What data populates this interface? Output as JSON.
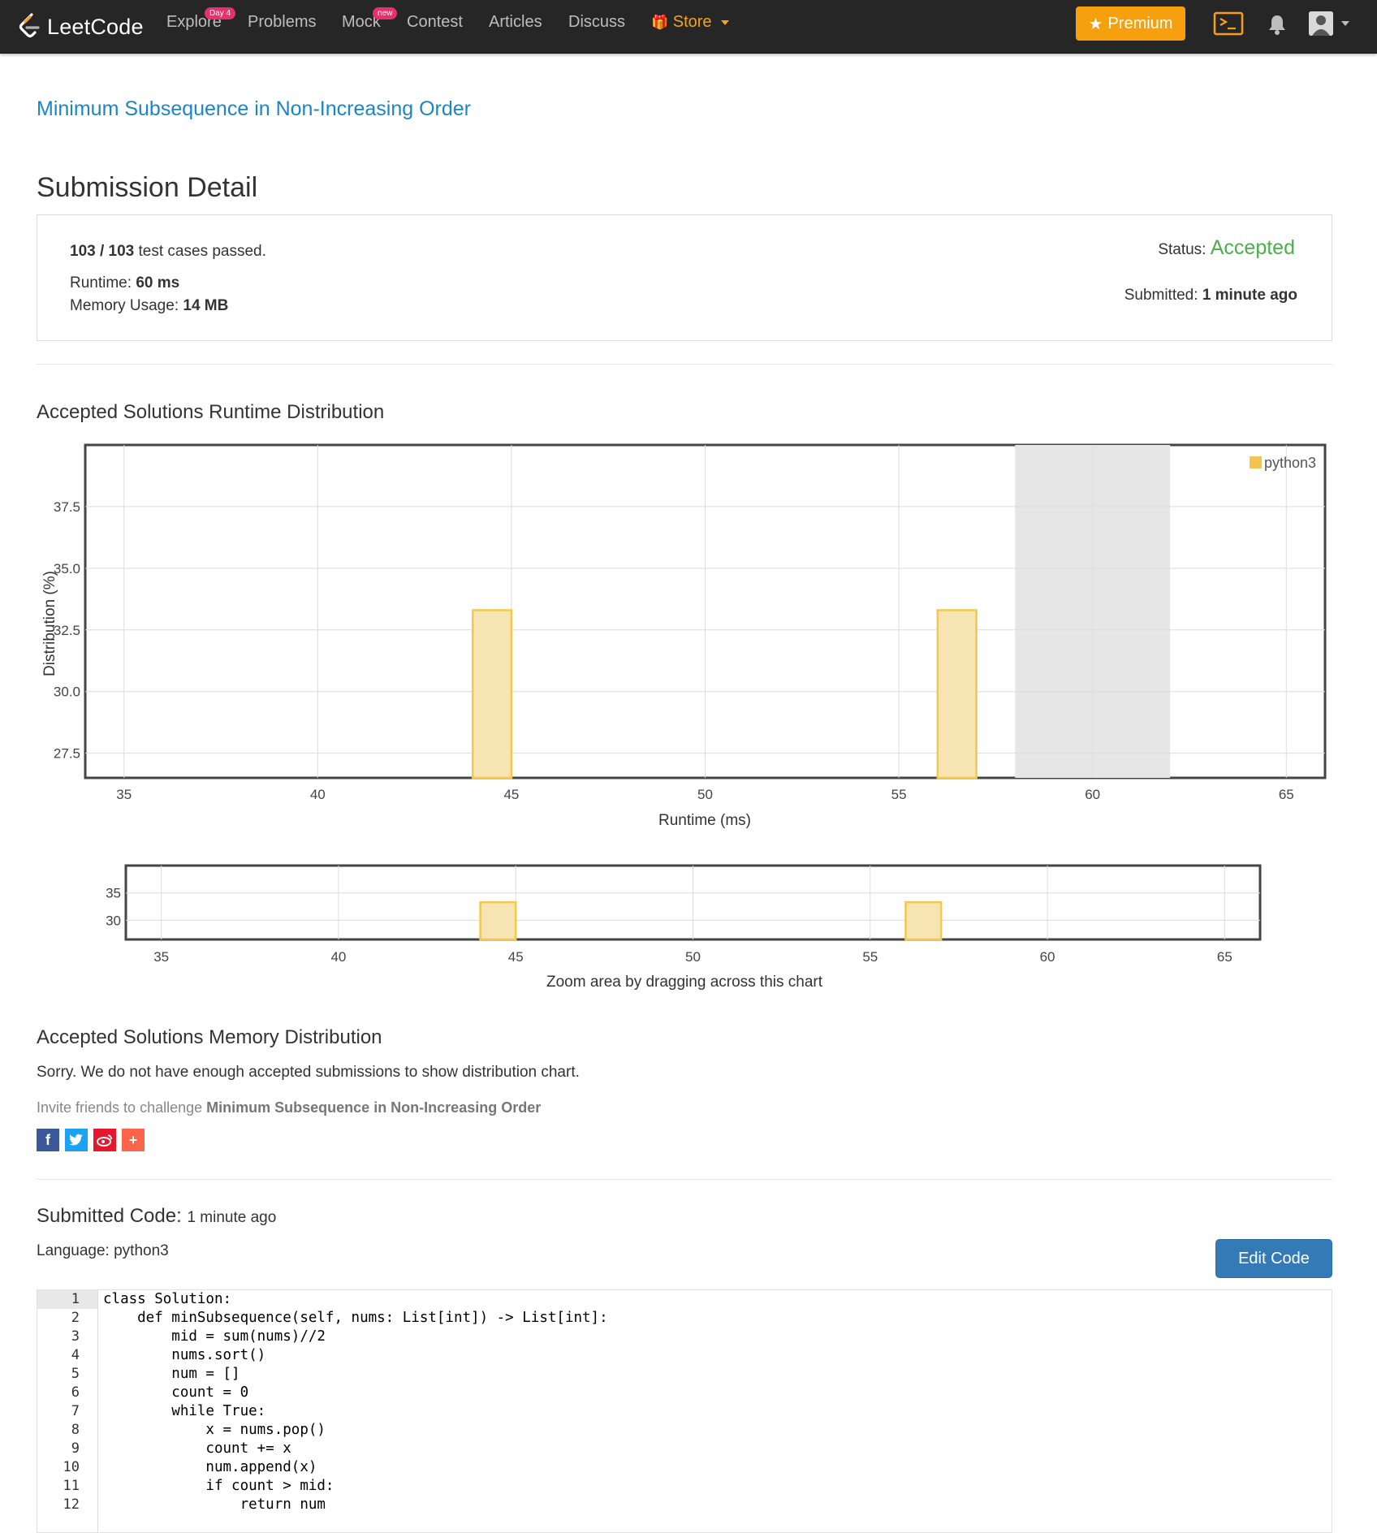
{
  "navbar": {
    "brand": "LeetCode",
    "items": [
      {
        "label": "Explore",
        "badge": "Day 4"
      },
      {
        "label": "Problems"
      },
      {
        "label": "Mock",
        "badge": "new"
      },
      {
        "label": "Contest"
      },
      {
        "label": "Articles"
      },
      {
        "label": "Discuss"
      },
      {
        "label": "Store"
      }
    ],
    "premium_label": "Premium",
    "accent": "#f7a00d",
    "icons": [
      "playground-icon",
      "bell-icon",
      "avatar",
      "caret-down-icon"
    ]
  },
  "problem_title": "Minimum Subsequence in Non-Increasing Order",
  "detail": {
    "heading": "Submission Detail",
    "passed_count": "103 / 103",
    "passed_text": "test cases passed.",
    "runtime_label": "Runtime:",
    "runtime_value": "60 ms",
    "memory_label": "Memory Usage:",
    "memory_value": "14 MB",
    "status_label": "Status:",
    "status_value": "Accepted",
    "status_color": "#4cae4c",
    "submitted_label": "Submitted:",
    "submitted_value": "1 minute ago"
  },
  "runtime_section": {
    "title": "Accepted Solutions Runtime Distribution",
    "zoom_hint": "Zoom area by dragging across this chart"
  },
  "chart_data": [
    {
      "type": "bar",
      "xlabel": "Runtime (ms)",
      "ylabel": "Distribution (%)",
      "legend": [
        "python3"
      ],
      "legend_position": "top-right",
      "x_ticks": [
        35,
        40,
        45,
        50,
        55,
        60,
        65
      ],
      "y_ticks": [
        27.5,
        30.0,
        32.5,
        35.0,
        37.5
      ],
      "xlim": [
        34,
        66
      ],
      "ylim": [
        26.5,
        40
      ],
      "highlight_range": [
        58,
        62
      ],
      "bar_color": "#f7e4b3",
      "bar_edge": "#f0c94e",
      "series": [
        {
          "name": "python3",
          "bars": [
            {
              "x_start": 44,
              "x_end": 45,
              "y": 33.3
            },
            {
              "x_start": 56,
              "x_end": 57,
              "y": 33.3
            }
          ]
        }
      ]
    },
    {
      "type": "bar",
      "x_ticks": [
        35,
        40,
        45,
        50,
        55,
        60,
        65
      ],
      "y_ticks": [
        30,
        35
      ],
      "xlim": [
        34,
        66
      ],
      "ylim": [
        26.5,
        40
      ],
      "series": [
        {
          "name": "python3",
          "bars": [
            {
              "x_start": 44,
              "x_end": 45,
              "y": 33.3
            },
            {
              "x_start": 56,
              "x_end": 57,
              "y": 33.3
            }
          ]
        }
      ]
    }
  ],
  "memory_section": {
    "title": "Accepted Solutions Memory Distribution",
    "message": "Sorry. We do not have enough accepted submissions to show distribution chart.",
    "invite_prefix": "Invite friends to challenge",
    "invite_problem": "Minimum Subsequence in Non-Increasing Order"
  },
  "share_icons": [
    "facebook-icon",
    "twitter-icon",
    "weibo-icon",
    "plus-icon"
  ],
  "code_section": {
    "title": "Submitted Code:",
    "time": "1 minute ago",
    "language_label": "Language:",
    "language": "python3",
    "edit_label": "Edit Code",
    "lines": [
      "class Solution:",
      "    def minSubsequence(self, nums: List[int]) -> List[int]:",
      "        mid = sum(nums)//2",
      "        nums.sort()",
      "        num = []",
      "        count = 0",
      "        while True:",
      "            x = nums.pop()",
      "            count += x",
      "            num.append(x)",
      "            if count > mid:",
      "                return num"
    ]
  }
}
